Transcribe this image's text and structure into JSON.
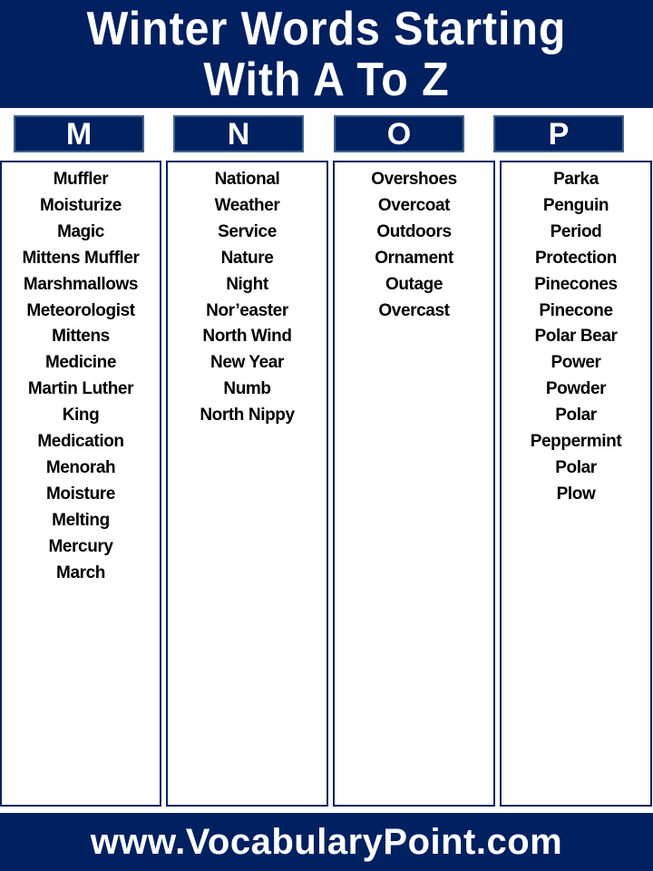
{
  "header": {
    "title_line1": "Winter Words Starting",
    "title_line2": "With A To Z"
  },
  "columns": [
    {
      "letter": "M",
      "words": [
        "Muffler",
        "Moisturize",
        "Magic",
        "Mittens Muffler",
        "Marshmallows",
        "Meteorologist",
        "Mittens",
        "Medicine",
        "Martin Luther",
        "King",
        "Medication",
        "Menorah",
        "Moisture",
        "Melting",
        "Mercury",
        "March"
      ]
    },
    {
      "letter": "N",
      "words": [
        "National",
        "Weather",
        "Service",
        "Nature",
        "Night",
        "Nor’easter",
        "North Wind",
        "New Year",
        "Numb",
        "North Nippy"
      ]
    },
    {
      "letter": "O",
      "words": [
        "Overshoes",
        "Overcoat",
        "Outdoors",
        "Ornament",
        "Outage",
        "Overcast"
      ]
    },
    {
      "letter": "P",
      "words": [
        "Parka",
        "Penguin",
        "Period",
        "Protection",
        "Pinecones",
        "Pinecone",
        "Polar Bear",
        "Power",
        "Powder",
        "Polar",
        "Peppermint",
        "Polar",
        "Plow"
      ]
    }
  ],
  "footer": {
    "website": "www.VocabularyPoint.com"
  },
  "colors": {
    "navy": "#002060",
    "letter_box_border": "#44658f",
    "text": "#000000"
  }
}
